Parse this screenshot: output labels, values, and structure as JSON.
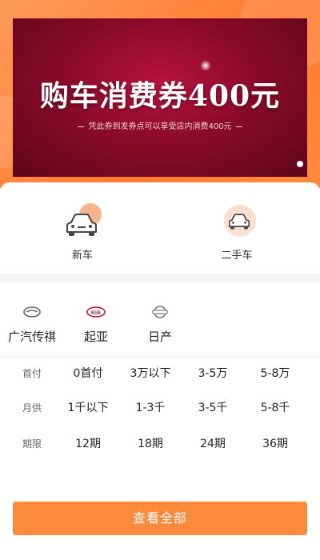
{
  "banner": {
    "title": "购车消费券400元",
    "subtitle": "凭此券到发券点可以享受店内消费400元"
  },
  "categories": [
    {
      "label": "新车",
      "icon": "new-car-icon"
    },
    {
      "label": "二手车",
      "icon": "used-car-icon"
    }
  ],
  "brands": [
    {
      "label": "广汽传祺",
      "icon": "trumpchi-logo-icon"
    },
    {
      "label": "起亚",
      "icon": "kia-logo-icon",
      "logo_text": "KIA"
    },
    {
      "label": "日产",
      "icon": "nissan-logo-icon"
    }
  ],
  "filters": [
    {
      "key": "首付",
      "options": [
        "0首付",
        "3万以下",
        "3-5万",
        "5-8万"
      ]
    },
    {
      "key": "月供",
      "options": [
        "1千以下",
        "1-3千",
        "3-5千",
        "5-8千"
      ]
    },
    {
      "key": "期限",
      "options": [
        "12期",
        "18期",
        "24期",
        "36期"
      ]
    }
  ],
  "button_label": "查看全部",
  "colors": {
    "accent": "#fb8a3c",
    "banner_red": "#8a0a2a"
  }
}
